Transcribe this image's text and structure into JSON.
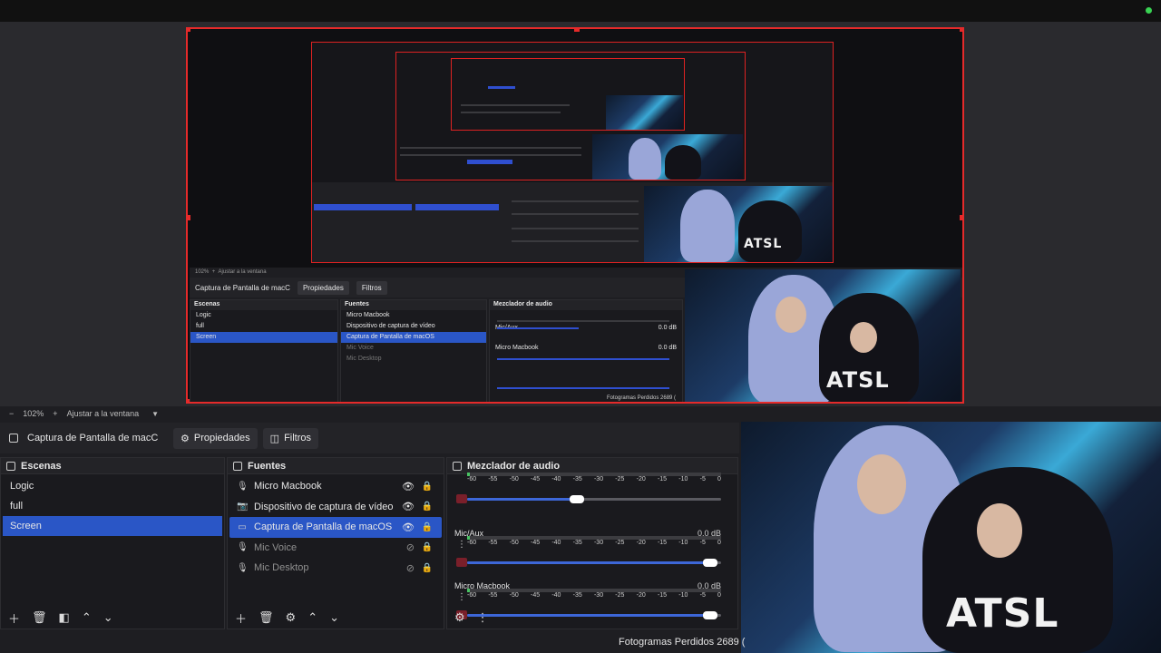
{
  "preview": {
    "zoom": "102%",
    "fit_label": "Ajustar a la ventana",
    "nested": {
      "zoom": "102%",
      "fit_label": "Ajustar a la ventana",
      "source_name": "Captura de Pantalla de macC",
      "properties_label": "Propiedades",
      "filters_label": "Filtros",
      "scenes_title": "Escenas",
      "scenes": [
        "Logic",
        "full",
        "Screen"
      ],
      "sources_title": "Fuentes",
      "sources": [
        "Micro Macbook",
        "Dispositivo de captura de vídeo",
        "Captura de Pantalla de macOS",
        "Mic Voice",
        "Mic Desktop"
      ],
      "mixer_title": "Mezclador de audio",
      "mixer_channels": [
        {
          "name": "Mic/Aux",
          "db": "0.0 dB"
        },
        {
          "name": "Micro Macbook",
          "db": "0.0 dB"
        }
      ],
      "dropped_frames": "Fotogramas Perdidos 2689 (",
      "logo": "ATSL"
    }
  },
  "source_toolbar": {
    "source_name": "Captura de Pantalla de macC",
    "properties_label": "Propiedades",
    "filters_label": "Filtros"
  },
  "scenes": {
    "title": "Escenas",
    "items": [
      {
        "label": "Logic",
        "selected": false
      },
      {
        "label": "full",
        "selected": false
      },
      {
        "label": "Screen",
        "selected": true
      }
    ]
  },
  "sources": {
    "title": "Fuentes",
    "items": [
      {
        "label": "Micro Macbook",
        "icon": "microphone-icon",
        "visible": true,
        "selected": false
      },
      {
        "label": "Dispositivo de captura de vídeo",
        "icon": "camera-icon",
        "visible": true,
        "selected": false
      },
      {
        "label": "Captura de Pantalla de macOS",
        "icon": "monitor-icon",
        "visible": true,
        "selected": true
      },
      {
        "label": "Mic Voice",
        "icon": "microphone-icon",
        "visible": false,
        "selected": false
      },
      {
        "label": "Mic Desktop",
        "icon": "microphone-icon",
        "visible": false,
        "selected": false
      }
    ]
  },
  "mixer": {
    "title": "Mezclador de audio",
    "scale": [
      "-60",
      "-55",
      "-50",
      "-45",
      "-40",
      "-35",
      "-30",
      "-25",
      "-20",
      "-15",
      "-10",
      "-5",
      "0"
    ],
    "channels": [
      {
        "name": "",
        "db": "",
        "volume": 0.44
      },
      {
        "name": "Mic/Aux",
        "db": "0.0 dB",
        "volume": 1.0
      },
      {
        "name": "Micro Macbook",
        "db": "0.0 dB",
        "volume": 1.0
      }
    ]
  },
  "status": {
    "dropped_frames": "Fotogramas Perdidos 2689 ("
  },
  "colors": {
    "accent": "#2a56c6",
    "selection_border": "#e52a2a",
    "meter_green": "#49c463",
    "slider_blue": "#3d67d8",
    "live_dot": "#39d353"
  },
  "camera_logo": "ATSL"
}
